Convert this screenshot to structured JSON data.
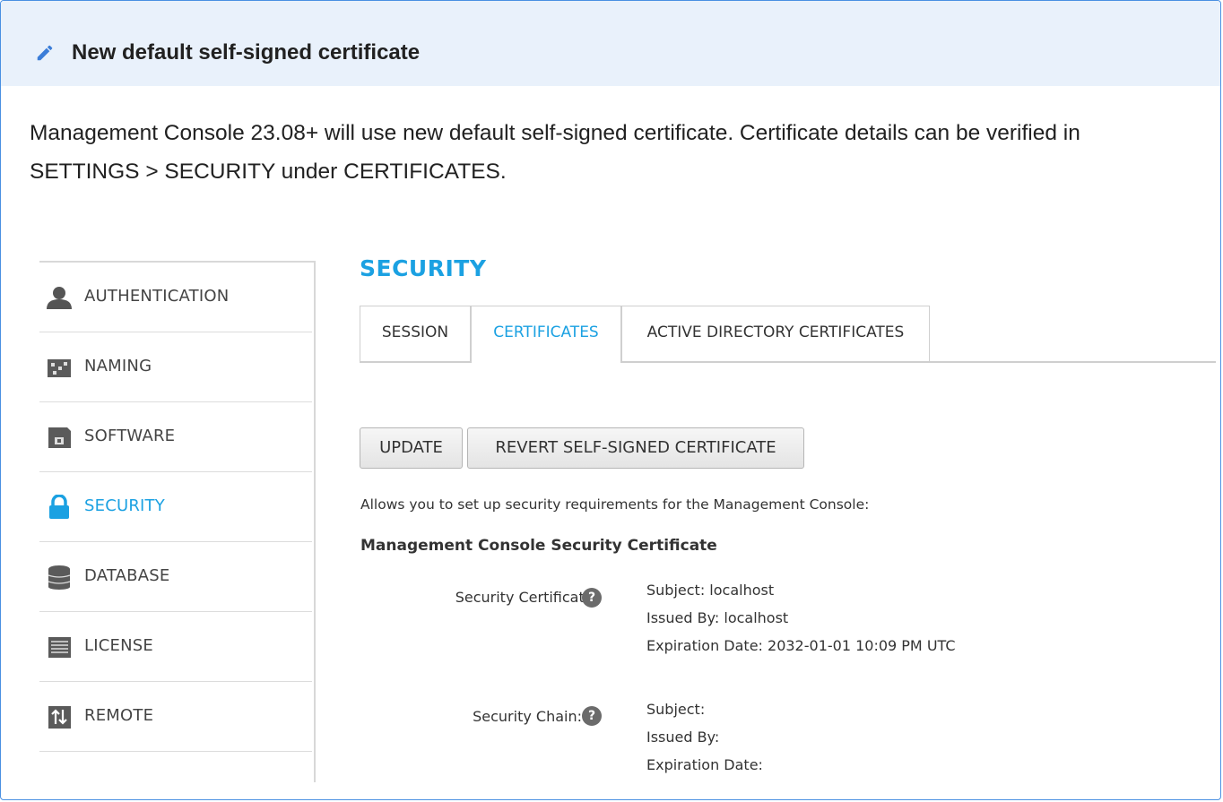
{
  "admonition": {
    "title": "New default self-signed certificate",
    "body": "Management Console 23.08+ will use new default self-signed certificate. Certificate details can be verified in SETTINGS > SECURITY under CERTIFICATES.",
    "colors": {
      "border": "#4a90e2",
      "header_bg": "#e9f1fb",
      "icon": "#3b7dd8"
    }
  },
  "sidebar": {
    "items": [
      {
        "label": "AUTHENTICATION",
        "icon": "user-icon"
      },
      {
        "label": "NAMING",
        "icon": "naming-icon"
      },
      {
        "label": "SOFTWARE",
        "icon": "software-icon"
      },
      {
        "label": "SECURITY",
        "icon": "lock-icon",
        "active": true
      },
      {
        "label": "DATABASE",
        "icon": "database-icon"
      },
      {
        "label": "LICENSE",
        "icon": "license-icon"
      },
      {
        "label": "REMOTE",
        "icon": "remote-arrows-icon"
      }
    ]
  },
  "main": {
    "title": "SECURITY",
    "tabs": [
      {
        "label": "SESSION"
      },
      {
        "label": "CERTIFICATES",
        "active": true
      },
      {
        "label": "ACTIVE DIRECTORY CERTIFICATES"
      }
    ],
    "buttons": {
      "update": "UPDATE",
      "revert": "REVERT SELF-SIGNED CERTIFICATE"
    },
    "description": "Allows you to set up security requirements for the Management Console:",
    "section_heading": "Management Console Security Certificate",
    "security_certificate": {
      "label": "Security Certificate:",
      "help": "?",
      "subject": "Subject: localhost",
      "issued_by": "Issued By: localhost",
      "expiration": "Expiration Date: 2032-01-01 10:09 PM UTC"
    },
    "security_chain": {
      "label": "Security Chain:",
      "help": "?",
      "subject": "Subject:",
      "issued_by": "Issued By:",
      "expiration": "Expiration Date:"
    },
    "accent_color": "#1ba1e2"
  }
}
